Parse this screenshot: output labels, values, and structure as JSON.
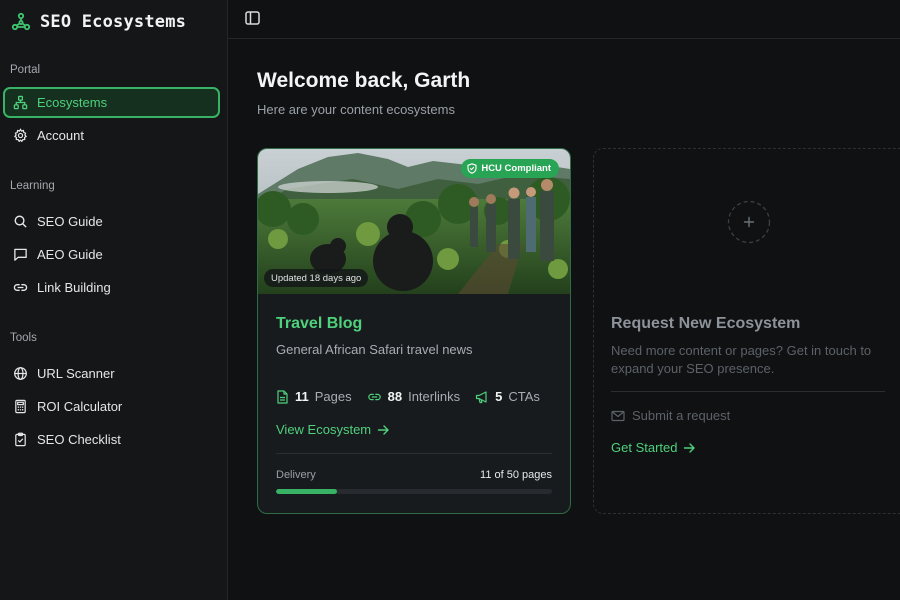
{
  "brand": {
    "name": "SEO Ecosystems",
    "icon": "network-icon"
  },
  "sidebar": {
    "sections": [
      {
        "label": "Portal",
        "items": [
          {
            "label": "Ecosystems",
            "icon": "network-icon",
            "active": true
          },
          {
            "label": "Account",
            "icon": "gear-icon"
          }
        ]
      },
      {
        "label": "Learning",
        "items": [
          {
            "label": "SEO Guide",
            "icon": "search-icon"
          },
          {
            "label": "AEO Guide",
            "icon": "chat-icon"
          },
          {
            "label": "Link Building",
            "icon": "link-icon"
          }
        ]
      },
      {
        "label": "Tools",
        "items": [
          {
            "label": "URL Scanner",
            "icon": "globe-icon"
          },
          {
            "label": "ROI Calculator",
            "icon": "calculator-icon"
          },
          {
            "label": "SEO Checklist",
            "icon": "clipboard-check-icon"
          }
        ]
      }
    ]
  },
  "topbar": {
    "toggle_icon": "sidebar-toggle-icon"
  },
  "main": {
    "welcome": "Welcome back, Garth",
    "subtitle": "Here are your content ecosystems"
  },
  "ecosystem_card": {
    "badge": "HCU Compliant",
    "updated": "Updated 18 days ago",
    "title": "Travel Blog",
    "description": "General African Safari travel news",
    "stats": {
      "pages_value": "11",
      "pages_label": "Pages",
      "interlinks_value": "88",
      "interlinks_label": "Interlinks",
      "ctas_value": "5",
      "ctas_label": "CTAs"
    },
    "view_label": "View Ecosystem",
    "delivery_label": "Delivery",
    "delivery_count": "11 of 50 pages",
    "delivery_fraction": 0.22
  },
  "request_card": {
    "title": "Request New Ecosystem",
    "description": "Need more content or pages? Get in touch to expand your SEO presence.",
    "submit_label": "Submit a request",
    "cta_label": "Get Started"
  },
  "colors": {
    "accent": "#4fd07c",
    "accent_dark": "#38b264",
    "badge": "#27a554",
    "background": "#0f1113",
    "sidebar": "#141618"
  }
}
